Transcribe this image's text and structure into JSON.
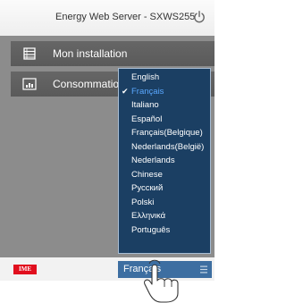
{
  "header": {
    "title": "Energy Web Server - SXWS255",
    "power_icon": "power-icon"
  },
  "menu": {
    "items": [
      {
        "label": "Mon installation",
        "icon": "building-icon"
      },
      {
        "label": "Consommations",
        "icon": "chart-icon"
      }
    ]
  },
  "footer": {
    "logo_text": "IME",
    "language_select": {
      "value": "Français",
      "icon": "menu-lines-icon"
    }
  },
  "dropdown": {
    "selected": "Français",
    "options": [
      "English",
      "Français",
      "Italiano",
      "Español",
      "Français(Belgique)",
      "Nederlands(België)",
      "Nederlands",
      "Chinese",
      "Русский",
      "Polski",
      "Ελληνικά",
      "Português"
    ]
  },
  "colors": {
    "menu_panel": "#8c8c8c",
    "menu_item": "#5e5e5e",
    "dropdown_bg": "#1b3f63",
    "select_bg": "#3d6ea1",
    "selected_text": "#5aa8ff",
    "logo_red": "#e10f1e"
  }
}
